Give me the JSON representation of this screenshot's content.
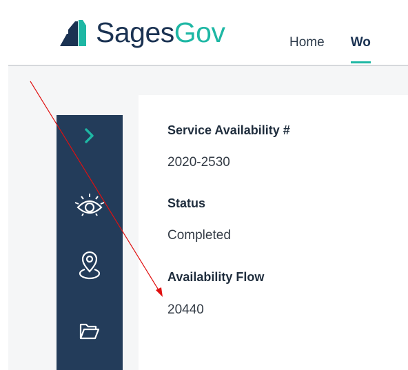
{
  "app": {
    "logo_part1": "Sages",
    "logo_part2": "Gov"
  },
  "nav": {
    "home": "Home",
    "work": "Wo"
  },
  "sidebar": {
    "items": [
      {
        "icon": "chevron-right-icon"
      },
      {
        "icon": "eye-icon"
      },
      {
        "icon": "location-pin-icon"
      },
      {
        "icon": "folder-icon"
      }
    ]
  },
  "details": {
    "service_label": "Service Availability #",
    "service_value": "2020-2530",
    "status_label": "Status",
    "status_value": "Completed",
    "flow_label": "Availability Flow",
    "flow_value": "20440"
  },
  "colors": {
    "navy": "#233c5a",
    "teal": "#1eb7a4",
    "annotation_red": "#e01010"
  }
}
